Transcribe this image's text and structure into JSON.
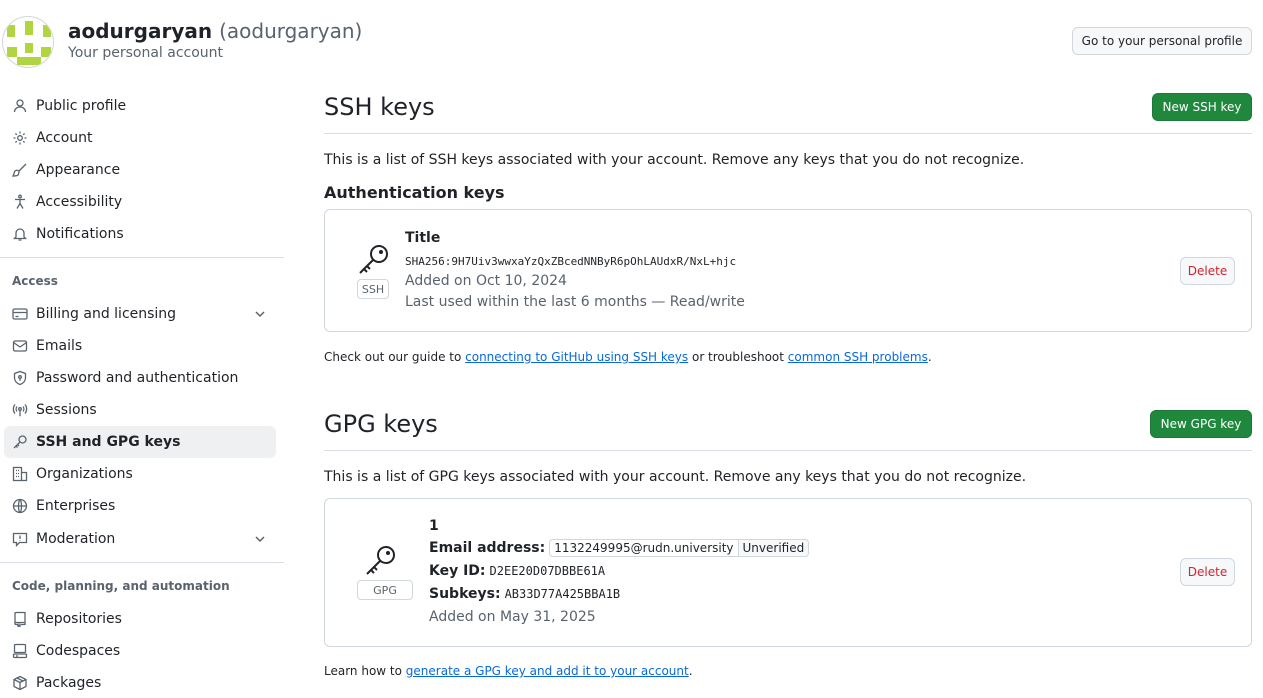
{
  "header": {
    "name": "aodurgaryan",
    "login": "(aodurgaryan)",
    "subtitle": "Your personal account",
    "profile_button": "Go to your personal profile"
  },
  "sidebar": {
    "items_top": [
      {
        "label": "Public profile",
        "icon": "person-icon"
      },
      {
        "label": "Account",
        "icon": "gear-icon"
      },
      {
        "label": "Appearance",
        "icon": "paintbrush-icon"
      },
      {
        "label": "Accessibility",
        "icon": "accessibility-icon"
      },
      {
        "label": "Notifications",
        "icon": "bell-icon"
      }
    ],
    "access_heading": "Access",
    "items_access": [
      {
        "label": "Billing and licensing",
        "icon": "credit-card-icon"
      },
      {
        "label": "Emails",
        "icon": "mail-icon"
      },
      {
        "label": "Password and authentication",
        "icon": "shield-lock-icon"
      },
      {
        "label": "Sessions",
        "icon": "broadcast-icon"
      },
      {
        "label": "SSH and GPG keys",
        "icon": "key-icon"
      },
      {
        "label": "Organizations",
        "icon": "organization-icon"
      },
      {
        "label": "Enterprises",
        "icon": "globe-icon"
      },
      {
        "label": "Moderation",
        "icon": "report-icon"
      }
    ],
    "code_heading": "Code, planning, and automation",
    "items_code": [
      {
        "label": "Repositories",
        "icon": "repo-icon"
      },
      {
        "label": "Codespaces",
        "icon": "codespaces-icon"
      },
      {
        "label": "Packages",
        "icon": "package-icon"
      }
    ]
  },
  "ssh": {
    "title": "SSH keys",
    "new_button": "New SSH key",
    "description": "This is a list of SSH keys associated with your account. Remove any keys that you do not recognize.",
    "auth_heading": "Authentication keys",
    "key": {
      "type_label": "SSH",
      "title": "Title",
      "fingerprint": "SHA256:9H7Uiv3wwxaYzQxZBcedNNByR6pOhLAUdxR/NxL+hjc",
      "added": "Added on Oct 10, 2024",
      "last_used": "Last used within the last 6 months — Read/write",
      "delete": "Delete"
    },
    "guide_prefix": "Check out our guide to ",
    "guide_link": "connecting to GitHub using SSH keys",
    "guide_mid": " or troubleshoot ",
    "problems_link": "common SSH problems",
    "guide_suffix": "."
  },
  "gpg": {
    "title": "GPG keys",
    "new_button": "New GPG key",
    "description": "This is a list of GPG keys associated with your account. Remove any keys that you do not recognize.",
    "key": {
      "type_label": "GPG",
      "title": "1",
      "email_label": "Email address:",
      "email": "1132249995@rudn.university",
      "email_status": "Unverified",
      "keyid_label": "Key ID:",
      "keyid": "D2EE20D07DBBE61A",
      "subkeys_label": "Subkeys:",
      "subkeys": "AB33D77A425BBA1B",
      "added": "Added on May 31, 2025",
      "delete": "Delete"
    },
    "learn_prefix": "Learn how to ",
    "learn_link": "generate a GPG key and add it to your account",
    "learn_suffix": "."
  },
  "colors": {
    "primary_green": "#1f883d",
    "danger_red": "#d1242f",
    "link_blue": "#0969da",
    "identicon_green": "#b0d540"
  }
}
